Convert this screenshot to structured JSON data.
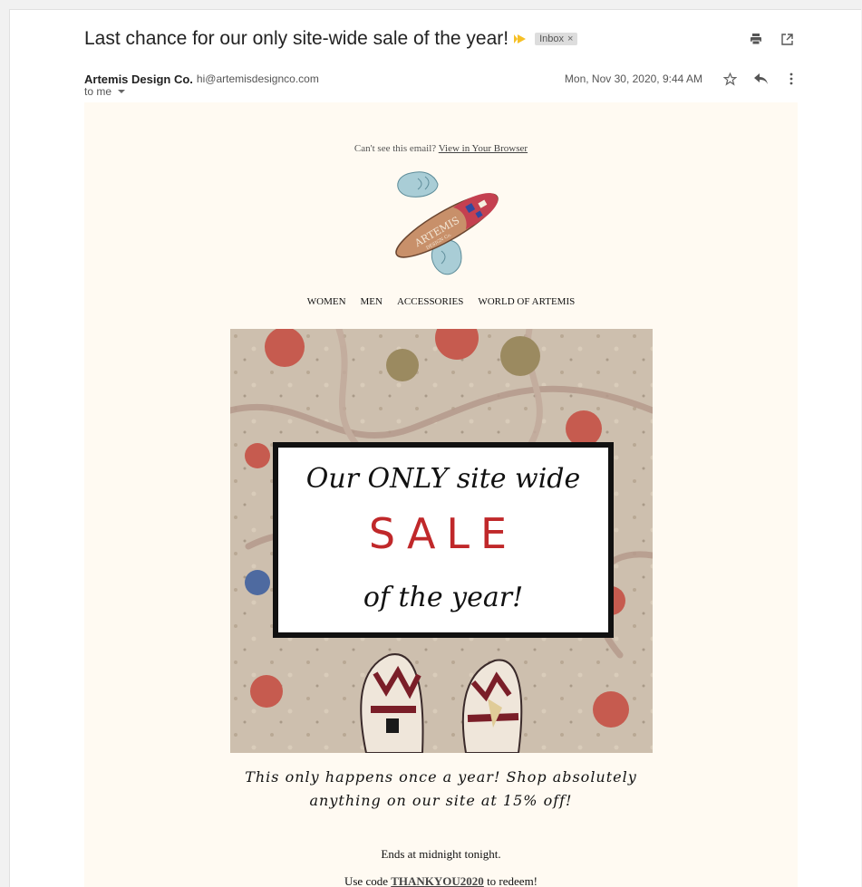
{
  "email": {
    "subject": "Last chance for our only site-wide sale of the year!",
    "label_chip": "Inbox",
    "label_chip_close": "×",
    "sender_name": "Artemis Design Co.",
    "sender_email": "hi@artemisdesignco.com",
    "date": "Mon, Nov 30, 2020, 9:44 AM",
    "to": "to me"
  },
  "icons": {
    "importance": "importance-marker-icon",
    "print": "print-icon",
    "popout": "open-in-new-window-icon",
    "star": "star-icon",
    "reply": "reply-icon",
    "more": "more-vert-icon",
    "caret": "chevron-down-icon"
  },
  "body": {
    "cant_see_prefix": "Can't see this email?",
    "view_browser_link": "View in Your Browser",
    "logo_text": "ARTEMIS",
    "logo_subtext": "DESIGN Co.",
    "nav": [
      "WOMEN",
      "MEN",
      "ACCESSORIES",
      "WORLD OF ARTEMIS"
    ],
    "hero_line1": "Our ONLY site wide",
    "hero_line2": "SALE",
    "hero_line3": "of the year!",
    "copy_line1": "This only happens once a year! Shop absolutely",
    "copy_line2": "anything on our site at 15% off!",
    "ends": "Ends at midnight tonight.",
    "code_prefix": "Use code",
    "code": "THANKYOU2020",
    "code_suffix": "to redeem!"
  },
  "colors": {
    "sale_red": "#c0282a",
    "email_bg": "#fffaf2",
    "importance_yellow": "#f6c026"
  }
}
